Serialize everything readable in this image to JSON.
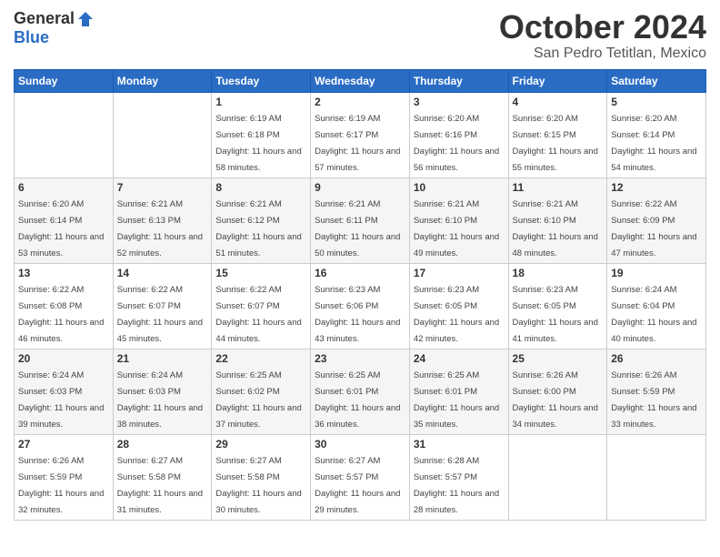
{
  "header": {
    "logo_general": "General",
    "logo_blue": "Blue",
    "month_title": "October 2024",
    "location": "San Pedro Tetitlan, Mexico"
  },
  "days_of_week": [
    "Sunday",
    "Monday",
    "Tuesday",
    "Wednesday",
    "Thursday",
    "Friday",
    "Saturday"
  ],
  "weeks": [
    [
      {
        "day": "",
        "info": ""
      },
      {
        "day": "",
        "info": ""
      },
      {
        "day": "1",
        "info": "Sunrise: 6:19 AM\nSunset: 6:18 PM\nDaylight: 11 hours and 58 minutes."
      },
      {
        "day": "2",
        "info": "Sunrise: 6:19 AM\nSunset: 6:17 PM\nDaylight: 11 hours and 57 minutes."
      },
      {
        "day": "3",
        "info": "Sunrise: 6:20 AM\nSunset: 6:16 PM\nDaylight: 11 hours and 56 minutes."
      },
      {
        "day": "4",
        "info": "Sunrise: 6:20 AM\nSunset: 6:15 PM\nDaylight: 11 hours and 55 minutes."
      },
      {
        "day": "5",
        "info": "Sunrise: 6:20 AM\nSunset: 6:14 PM\nDaylight: 11 hours and 54 minutes."
      }
    ],
    [
      {
        "day": "6",
        "info": "Sunrise: 6:20 AM\nSunset: 6:14 PM\nDaylight: 11 hours and 53 minutes."
      },
      {
        "day": "7",
        "info": "Sunrise: 6:21 AM\nSunset: 6:13 PM\nDaylight: 11 hours and 52 minutes."
      },
      {
        "day": "8",
        "info": "Sunrise: 6:21 AM\nSunset: 6:12 PM\nDaylight: 11 hours and 51 minutes."
      },
      {
        "day": "9",
        "info": "Sunrise: 6:21 AM\nSunset: 6:11 PM\nDaylight: 11 hours and 50 minutes."
      },
      {
        "day": "10",
        "info": "Sunrise: 6:21 AM\nSunset: 6:10 PM\nDaylight: 11 hours and 49 minutes."
      },
      {
        "day": "11",
        "info": "Sunrise: 6:21 AM\nSunset: 6:10 PM\nDaylight: 11 hours and 48 minutes."
      },
      {
        "day": "12",
        "info": "Sunrise: 6:22 AM\nSunset: 6:09 PM\nDaylight: 11 hours and 47 minutes."
      }
    ],
    [
      {
        "day": "13",
        "info": "Sunrise: 6:22 AM\nSunset: 6:08 PM\nDaylight: 11 hours and 46 minutes."
      },
      {
        "day": "14",
        "info": "Sunrise: 6:22 AM\nSunset: 6:07 PM\nDaylight: 11 hours and 45 minutes."
      },
      {
        "day": "15",
        "info": "Sunrise: 6:22 AM\nSunset: 6:07 PM\nDaylight: 11 hours and 44 minutes."
      },
      {
        "day": "16",
        "info": "Sunrise: 6:23 AM\nSunset: 6:06 PM\nDaylight: 11 hours and 43 minutes."
      },
      {
        "day": "17",
        "info": "Sunrise: 6:23 AM\nSunset: 6:05 PM\nDaylight: 11 hours and 42 minutes."
      },
      {
        "day": "18",
        "info": "Sunrise: 6:23 AM\nSunset: 6:05 PM\nDaylight: 11 hours and 41 minutes."
      },
      {
        "day": "19",
        "info": "Sunrise: 6:24 AM\nSunset: 6:04 PM\nDaylight: 11 hours and 40 minutes."
      }
    ],
    [
      {
        "day": "20",
        "info": "Sunrise: 6:24 AM\nSunset: 6:03 PM\nDaylight: 11 hours and 39 minutes."
      },
      {
        "day": "21",
        "info": "Sunrise: 6:24 AM\nSunset: 6:03 PM\nDaylight: 11 hours and 38 minutes."
      },
      {
        "day": "22",
        "info": "Sunrise: 6:25 AM\nSunset: 6:02 PM\nDaylight: 11 hours and 37 minutes."
      },
      {
        "day": "23",
        "info": "Sunrise: 6:25 AM\nSunset: 6:01 PM\nDaylight: 11 hours and 36 minutes."
      },
      {
        "day": "24",
        "info": "Sunrise: 6:25 AM\nSunset: 6:01 PM\nDaylight: 11 hours and 35 minutes."
      },
      {
        "day": "25",
        "info": "Sunrise: 6:26 AM\nSunset: 6:00 PM\nDaylight: 11 hours and 34 minutes."
      },
      {
        "day": "26",
        "info": "Sunrise: 6:26 AM\nSunset: 5:59 PM\nDaylight: 11 hours and 33 minutes."
      }
    ],
    [
      {
        "day": "27",
        "info": "Sunrise: 6:26 AM\nSunset: 5:59 PM\nDaylight: 11 hours and 32 minutes."
      },
      {
        "day": "28",
        "info": "Sunrise: 6:27 AM\nSunset: 5:58 PM\nDaylight: 11 hours and 31 minutes."
      },
      {
        "day": "29",
        "info": "Sunrise: 6:27 AM\nSunset: 5:58 PM\nDaylight: 11 hours and 30 minutes."
      },
      {
        "day": "30",
        "info": "Sunrise: 6:27 AM\nSunset: 5:57 PM\nDaylight: 11 hours and 29 minutes."
      },
      {
        "day": "31",
        "info": "Sunrise: 6:28 AM\nSunset: 5:57 PM\nDaylight: 11 hours and 28 minutes."
      },
      {
        "day": "",
        "info": ""
      },
      {
        "day": "",
        "info": ""
      }
    ]
  ]
}
